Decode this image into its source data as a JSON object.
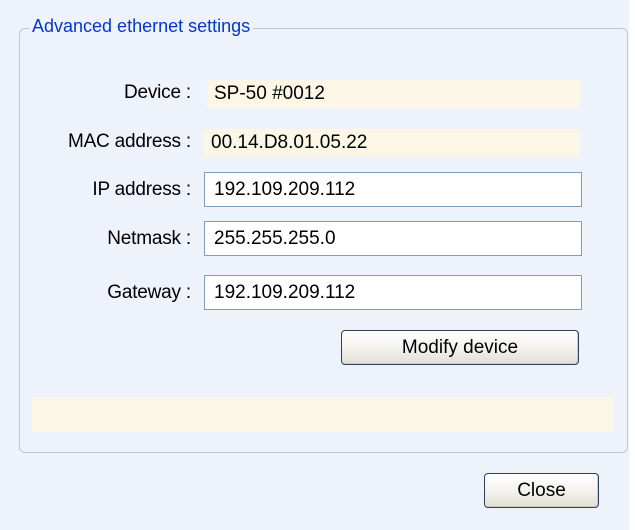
{
  "group": {
    "title": "Advanced ethernet settings"
  },
  "fields": {
    "device": {
      "label": "Device :",
      "value": "SP-50 #0012"
    },
    "mac": {
      "label": "MAC address :",
      "value": "00.14.D8.01.05.22"
    },
    "ip": {
      "label": "IP address :",
      "value": "192.109.209.112"
    },
    "netmask": {
      "label": "Netmask :",
      "value": "255.255.255.0"
    },
    "gateway": {
      "label": "Gateway :",
      "value": "192.109.209.112"
    }
  },
  "buttons": {
    "modify_label": "Modify device",
    "close_label": "Close"
  },
  "status": {
    "message": ""
  },
  "colors": {
    "group_title": "#0038cc",
    "readonly_background": "#fbf6e6",
    "window_background": "#eef2fb",
    "input_border": "#7f9db9"
  }
}
